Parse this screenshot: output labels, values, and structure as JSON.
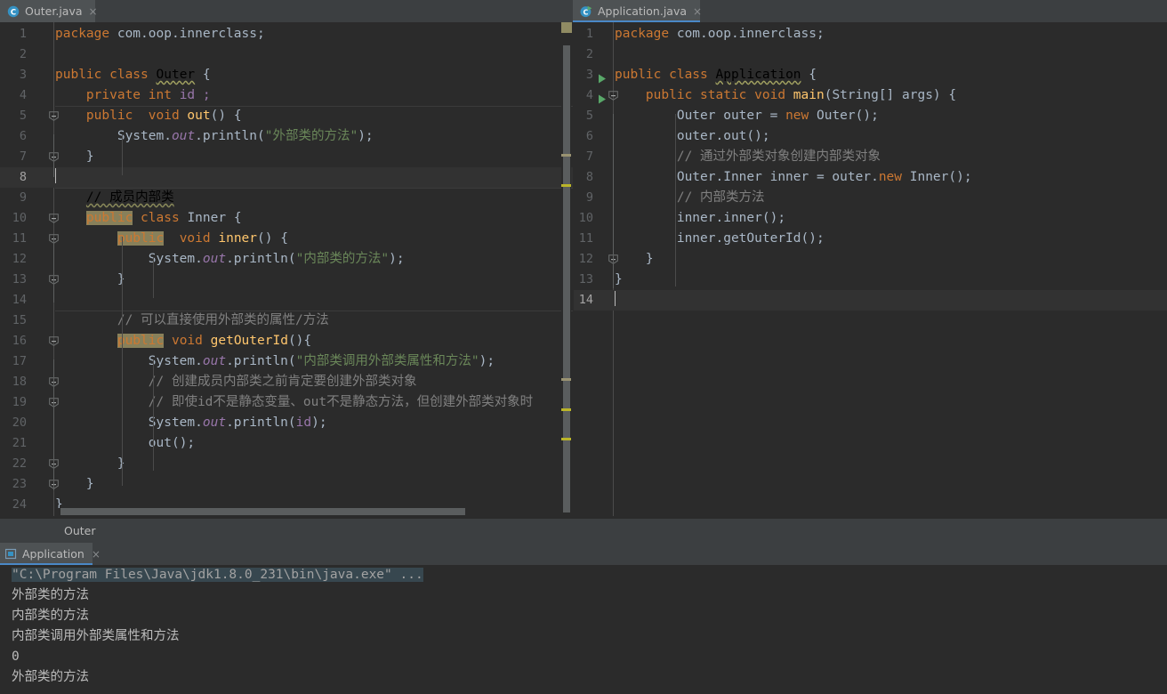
{
  "window": {
    "theme_bg": "#2b2b2b",
    "panel_bg": "#3c3f41",
    "accent": "#4a88c7"
  },
  "editor_tabs": {
    "left": {
      "label": "Outer.java",
      "icon": "java-class-icon",
      "close": "×",
      "active": false
    },
    "right": {
      "label": "Application.java",
      "icon": "java-runnable-class-icon",
      "close": "×",
      "active": true
    }
  },
  "left_editor": {
    "file": "Outer.java",
    "caret_line": 8,
    "lines": [
      {
        "n": "1",
        "segs": [
          {
            "t": "package ",
            "c": "kw"
          },
          {
            "t": "com.oop.innerclass;",
            "c": "id"
          }
        ]
      },
      {
        "n": "2",
        "segs": []
      },
      {
        "n": "3",
        "segs": [
          {
            "t": "public class ",
            "c": "kw"
          },
          {
            "t": "Outer",
            "c": "warnsq"
          },
          {
            "t": " {",
            "c": "id"
          }
        ]
      },
      {
        "n": "4",
        "segs": [
          {
            "t": "    ",
            "c": "id"
          },
          {
            "t": "private int ",
            "c": "kw"
          },
          {
            "t": "id ;",
            "c": "fld2"
          }
        ]
      },
      {
        "n": "5",
        "segs": [
          {
            "t": "    ",
            "c": "id"
          },
          {
            "t": "public  void ",
            "c": "kw"
          },
          {
            "t": "out",
            "c": "mth"
          },
          {
            "t": "() {",
            "c": "id"
          }
        ]
      },
      {
        "n": "6",
        "segs": [
          {
            "t": "        System.",
            "c": "id"
          },
          {
            "t": "out",
            "c": "fld"
          },
          {
            "t": ".println(",
            "c": "id"
          },
          {
            "t": "\"外部类的方法\"",
            "c": "str"
          },
          {
            "t": ");",
            "c": "id"
          }
        ]
      },
      {
        "n": "7",
        "segs": [
          {
            "t": "    }",
            "c": "id"
          }
        ]
      },
      {
        "n": "8",
        "segs": []
      },
      {
        "n": "9",
        "segs": [
          {
            "t": "    ",
            "c": "id"
          },
          {
            "t": "// 成员内部类",
            "c": "cmtsq"
          }
        ]
      },
      {
        "n": "10",
        "segs": [
          {
            "t": "    ",
            "c": "id"
          },
          {
            "t": "public",
            "c": "hl"
          },
          {
            "t": " ",
            "c": "id"
          },
          {
            "t": "class ",
            "c": "kw"
          },
          {
            "t": "Inner {",
            "c": "id"
          }
        ]
      },
      {
        "n": "11",
        "segs": [
          {
            "t": "        ",
            "c": "id"
          },
          {
            "t": "public",
            "c": "hl"
          },
          {
            "t": "  ",
            "c": "id"
          },
          {
            "t": "void ",
            "c": "kw"
          },
          {
            "t": "inner",
            "c": "mth"
          },
          {
            "t": "() {",
            "c": "id"
          }
        ]
      },
      {
        "n": "12",
        "segs": [
          {
            "t": "            System.",
            "c": "id"
          },
          {
            "t": "out",
            "c": "fld"
          },
          {
            "t": ".println(",
            "c": "id"
          },
          {
            "t": "\"内部类的方法\"",
            "c": "str"
          },
          {
            "t": ");",
            "c": "id"
          }
        ]
      },
      {
        "n": "13",
        "segs": [
          {
            "t": "        }",
            "c": "id"
          }
        ]
      },
      {
        "n": "14",
        "segs": []
      },
      {
        "n": "15",
        "segs": [
          {
            "t": "        ",
            "c": "id"
          },
          {
            "t": "// 可以直接使用外部类的属性/方法",
            "c": "cmt"
          }
        ]
      },
      {
        "n": "16",
        "segs": [
          {
            "t": "        ",
            "c": "id"
          },
          {
            "t": "public",
            "c": "hl"
          },
          {
            "t": " ",
            "c": "id"
          },
          {
            "t": "void ",
            "c": "kw"
          },
          {
            "t": "getOuterId",
            "c": "mth"
          },
          {
            "t": "(){",
            "c": "id"
          }
        ]
      },
      {
        "n": "17",
        "segs": [
          {
            "t": "            System.",
            "c": "id"
          },
          {
            "t": "out",
            "c": "fld"
          },
          {
            "t": ".println(",
            "c": "id"
          },
          {
            "t": "\"内部类调用外部类属性和方法\"",
            "c": "str"
          },
          {
            "t": ");",
            "c": "id"
          }
        ]
      },
      {
        "n": "18",
        "segs": [
          {
            "t": "            ",
            "c": "id"
          },
          {
            "t": "// 创建成员内部类之前肯定要创建外部类对象",
            "c": "cmt"
          }
        ]
      },
      {
        "n": "19",
        "segs": [
          {
            "t": "            ",
            "c": "id"
          },
          {
            "t": "// 即使id不是静态变量、out不是静态方法，但创建外部类对象时",
            "c": "cmt"
          }
        ]
      },
      {
        "n": "20",
        "segs": [
          {
            "t": "            System.",
            "c": "id"
          },
          {
            "t": "out",
            "c": "fld"
          },
          {
            "t": ".println(",
            "c": "id"
          },
          {
            "t": "id",
            "c": "fld2"
          },
          {
            "t": ");",
            "c": "id"
          }
        ]
      },
      {
        "n": "21",
        "segs": [
          {
            "t": "            ",
            "c": "id"
          },
          {
            "t": "out",
            "c": "id"
          },
          {
            "t": "();",
            "c": "id"
          }
        ]
      },
      {
        "n": "22",
        "segs": [
          {
            "t": "        }",
            "c": "id"
          }
        ]
      },
      {
        "n": "23",
        "segs": [
          {
            "t": "    }",
            "c": "id"
          }
        ]
      },
      {
        "n": "24",
        "segs": [
          {
            "t": "}",
            "c": "id"
          }
        ]
      }
    ]
  },
  "right_editor": {
    "file": "Application.java",
    "caret_line": 14,
    "lines": [
      {
        "n": "1",
        "segs": [
          {
            "t": "package ",
            "c": "kw"
          },
          {
            "t": "com.oop.innerclass;",
            "c": "id"
          }
        ]
      },
      {
        "n": "2",
        "segs": []
      },
      {
        "n": "3",
        "segs": [
          {
            "t": "public class ",
            "c": "kw"
          },
          {
            "t": "Application",
            "c": "warnsq"
          },
          {
            "t": " {",
            "c": "id"
          }
        ]
      },
      {
        "n": "4",
        "segs": [
          {
            "t": "    ",
            "c": "id"
          },
          {
            "t": "public static void ",
            "c": "kw"
          },
          {
            "t": "main",
            "c": "mth"
          },
          {
            "t": "(String[] args) {",
            "c": "id"
          }
        ]
      },
      {
        "n": "5",
        "segs": [
          {
            "t": "        Outer outer = ",
            "c": "id"
          },
          {
            "t": "new ",
            "c": "kw"
          },
          {
            "t": "Outer();",
            "c": "id"
          }
        ]
      },
      {
        "n": "6",
        "segs": [
          {
            "t": "        outer.out();",
            "c": "id"
          }
        ]
      },
      {
        "n": "7",
        "segs": [
          {
            "t": "        ",
            "c": "id"
          },
          {
            "t": "// 通过外部类对象创建内部类对象",
            "c": "cmt"
          }
        ]
      },
      {
        "n": "8",
        "segs": [
          {
            "t": "        Outer.Inner inner = outer.",
            "c": "id"
          },
          {
            "t": "new ",
            "c": "kw"
          },
          {
            "t": "Inner();",
            "c": "id"
          }
        ]
      },
      {
        "n": "9",
        "segs": [
          {
            "t": "        ",
            "c": "id"
          },
          {
            "t": "// 内部类方法",
            "c": "cmt"
          }
        ]
      },
      {
        "n": "10",
        "segs": [
          {
            "t": "        inner.inner();",
            "c": "id"
          }
        ]
      },
      {
        "n": "11",
        "segs": [
          {
            "t": "        inner.getOuterId();",
            "c": "id"
          }
        ]
      },
      {
        "n": "12",
        "segs": [
          {
            "t": "    }",
            "c": "id"
          }
        ]
      },
      {
        "n": "13",
        "segs": [
          {
            "t": "}",
            "c": "id"
          }
        ]
      },
      {
        "n": "14",
        "segs": []
      }
    ],
    "run_arrow_lines": [
      3,
      4
    ]
  },
  "breadcrumb": {
    "crumb": "Outer"
  },
  "console": {
    "tab": {
      "label": "Application",
      "icon": "run-console-icon",
      "close": "×"
    },
    "output": [
      {
        "text": "\"C:\\Program Files\\Java\\jdk1.8.0_231\\bin\\java.exe\" ...",
        "kind": "cmd"
      },
      {
        "text": "外部类的方法",
        "kind": "out"
      },
      {
        "text": "内部类的方法",
        "kind": "out"
      },
      {
        "text": "内部类调用外部类属性和方法",
        "kind": "out"
      },
      {
        "text": "0",
        "kind": "out"
      },
      {
        "text": "外部类的方法",
        "kind": "out"
      }
    ]
  }
}
